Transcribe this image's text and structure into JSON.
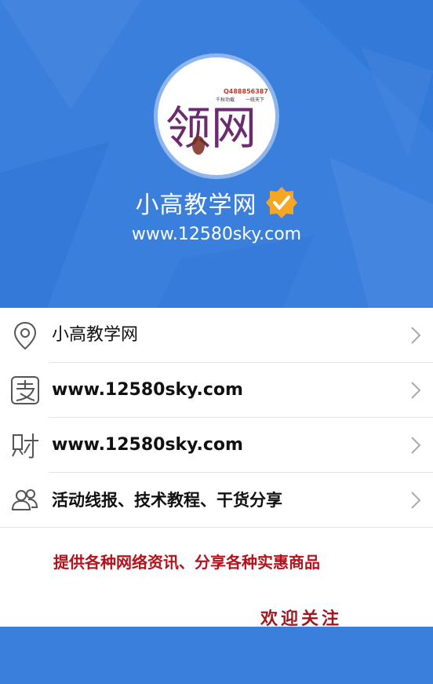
{
  "profile": {
    "logo_text": "领网",
    "logo_number": "Q488856387",
    "logo_slogan_left": "千秋功载",
    "logo_slogan_right": "一统天下",
    "name": "小高教学网",
    "url": "www.12580sky.com",
    "verified": true
  },
  "list": {
    "items": [
      {
        "icon": "location-pin-icon",
        "label": "小高教学网"
      },
      {
        "icon": "alipay-icon",
        "label": "www.12580sky.com"
      },
      {
        "icon": "wealth-icon",
        "label": "www.12580sky.com"
      },
      {
        "icon": "users-icon",
        "label": "活动线报、技术教程、干货分享"
      }
    ]
  },
  "promo": {
    "text": "提供各种网络资讯、分享各种实惠商品",
    "welcome": "欢迎关注"
  },
  "colors": {
    "header_bg": "#3a7fdc",
    "verified_badge": "#f5a623",
    "promo_text": "#b5121b"
  }
}
